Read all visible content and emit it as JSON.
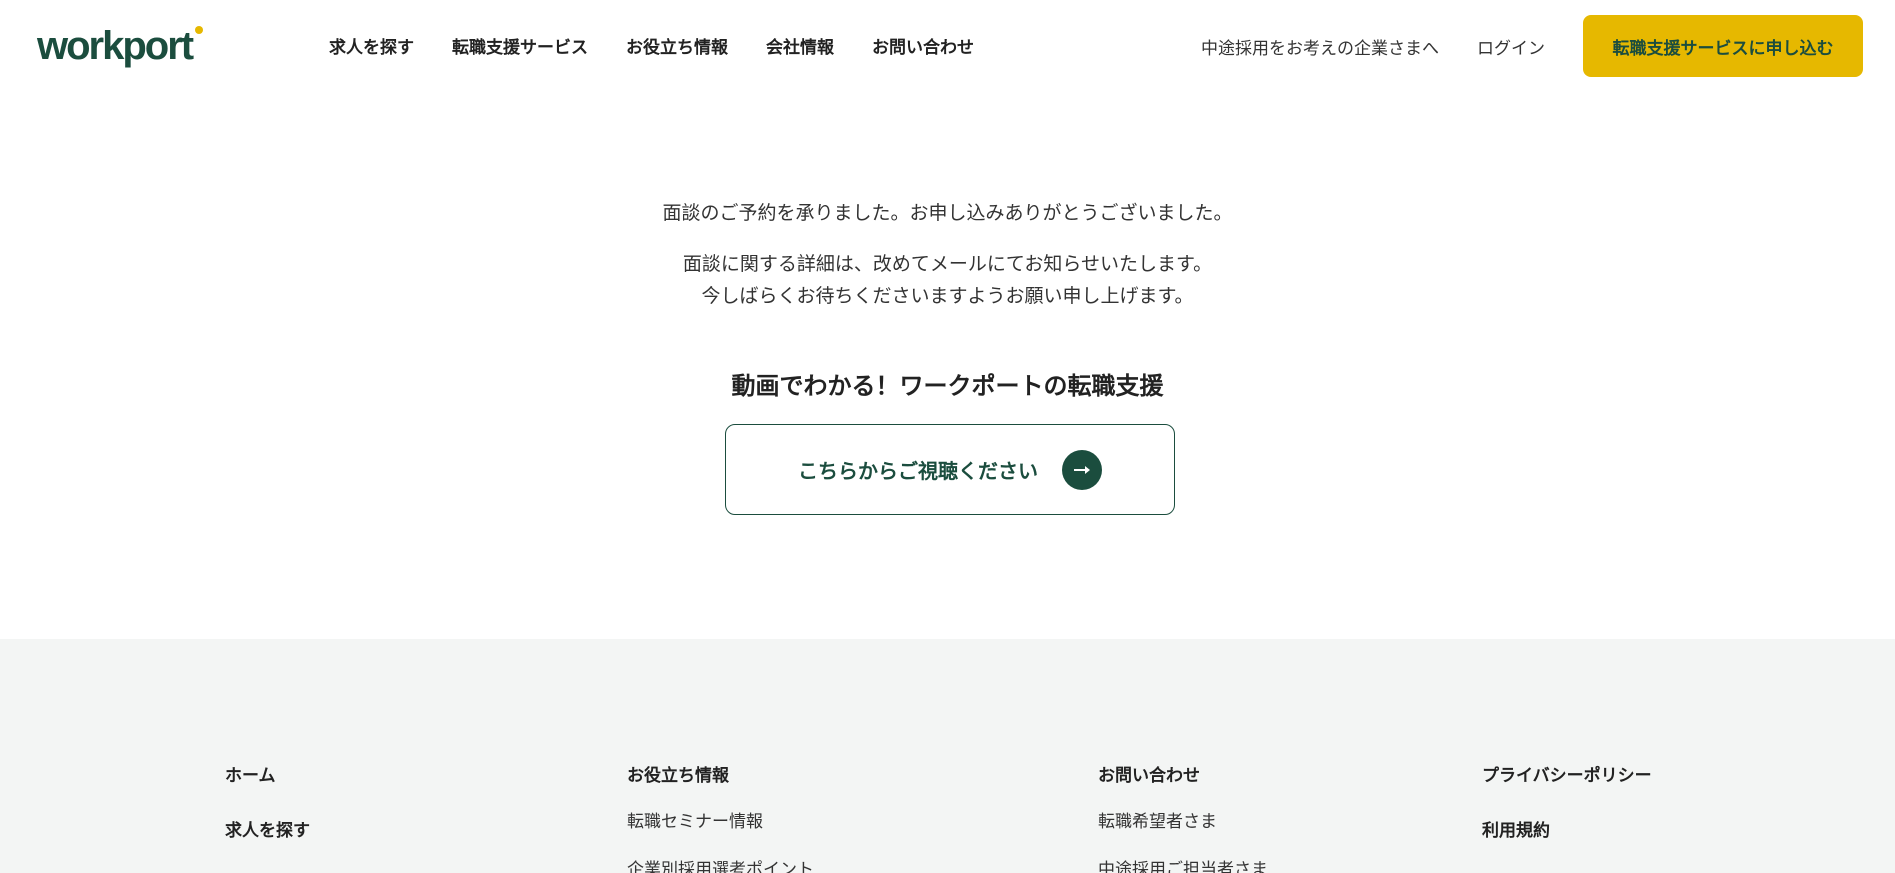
{
  "header": {
    "logo": "workport",
    "nav": [
      "求人を探す",
      "転職支援サービス",
      "お役立ち情報",
      "会社情報",
      "お問い合わせ"
    ],
    "employer_link": "中途採用をお考えの企業さまへ",
    "login": "ログイン",
    "cta": "転職支援サービスに申し込む"
  },
  "main": {
    "message_1": "面談のご予約を承りました。お申し込みありがとうございました。",
    "message_2_line1": "面談に関する詳細は、改めてメールにてお知らせいたします。",
    "message_2_line2": "今しばらくお待ちくださいますようお願い申し上げます。",
    "video_heading": "動画でわかる！ワークポートの転職支援",
    "video_button": "こちらからご視聴ください"
  },
  "footer": {
    "col1": {
      "item1": "ホーム",
      "item2": "求人を探す"
    },
    "col2": {
      "heading": "お役立ち情報",
      "item1": "転職セミナー情報",
      "item2": "企業別採用選考ポイント"
    },
    "col3": {
      "heading": "お問い合わせ",
      "item1": "転職希望者さま",
      "item2": "中途採用ご担当者さま"
    },
    "col4": {
      "item1": "プライバシーポリシー",
      "item2": "利用規約"
    }
  },
  "colors": {
    "brand_green": "#1b4d3e",
    "accent_yellow": "#e6b800",
    "footer_bg": "#f3f5f4"
  }
}
